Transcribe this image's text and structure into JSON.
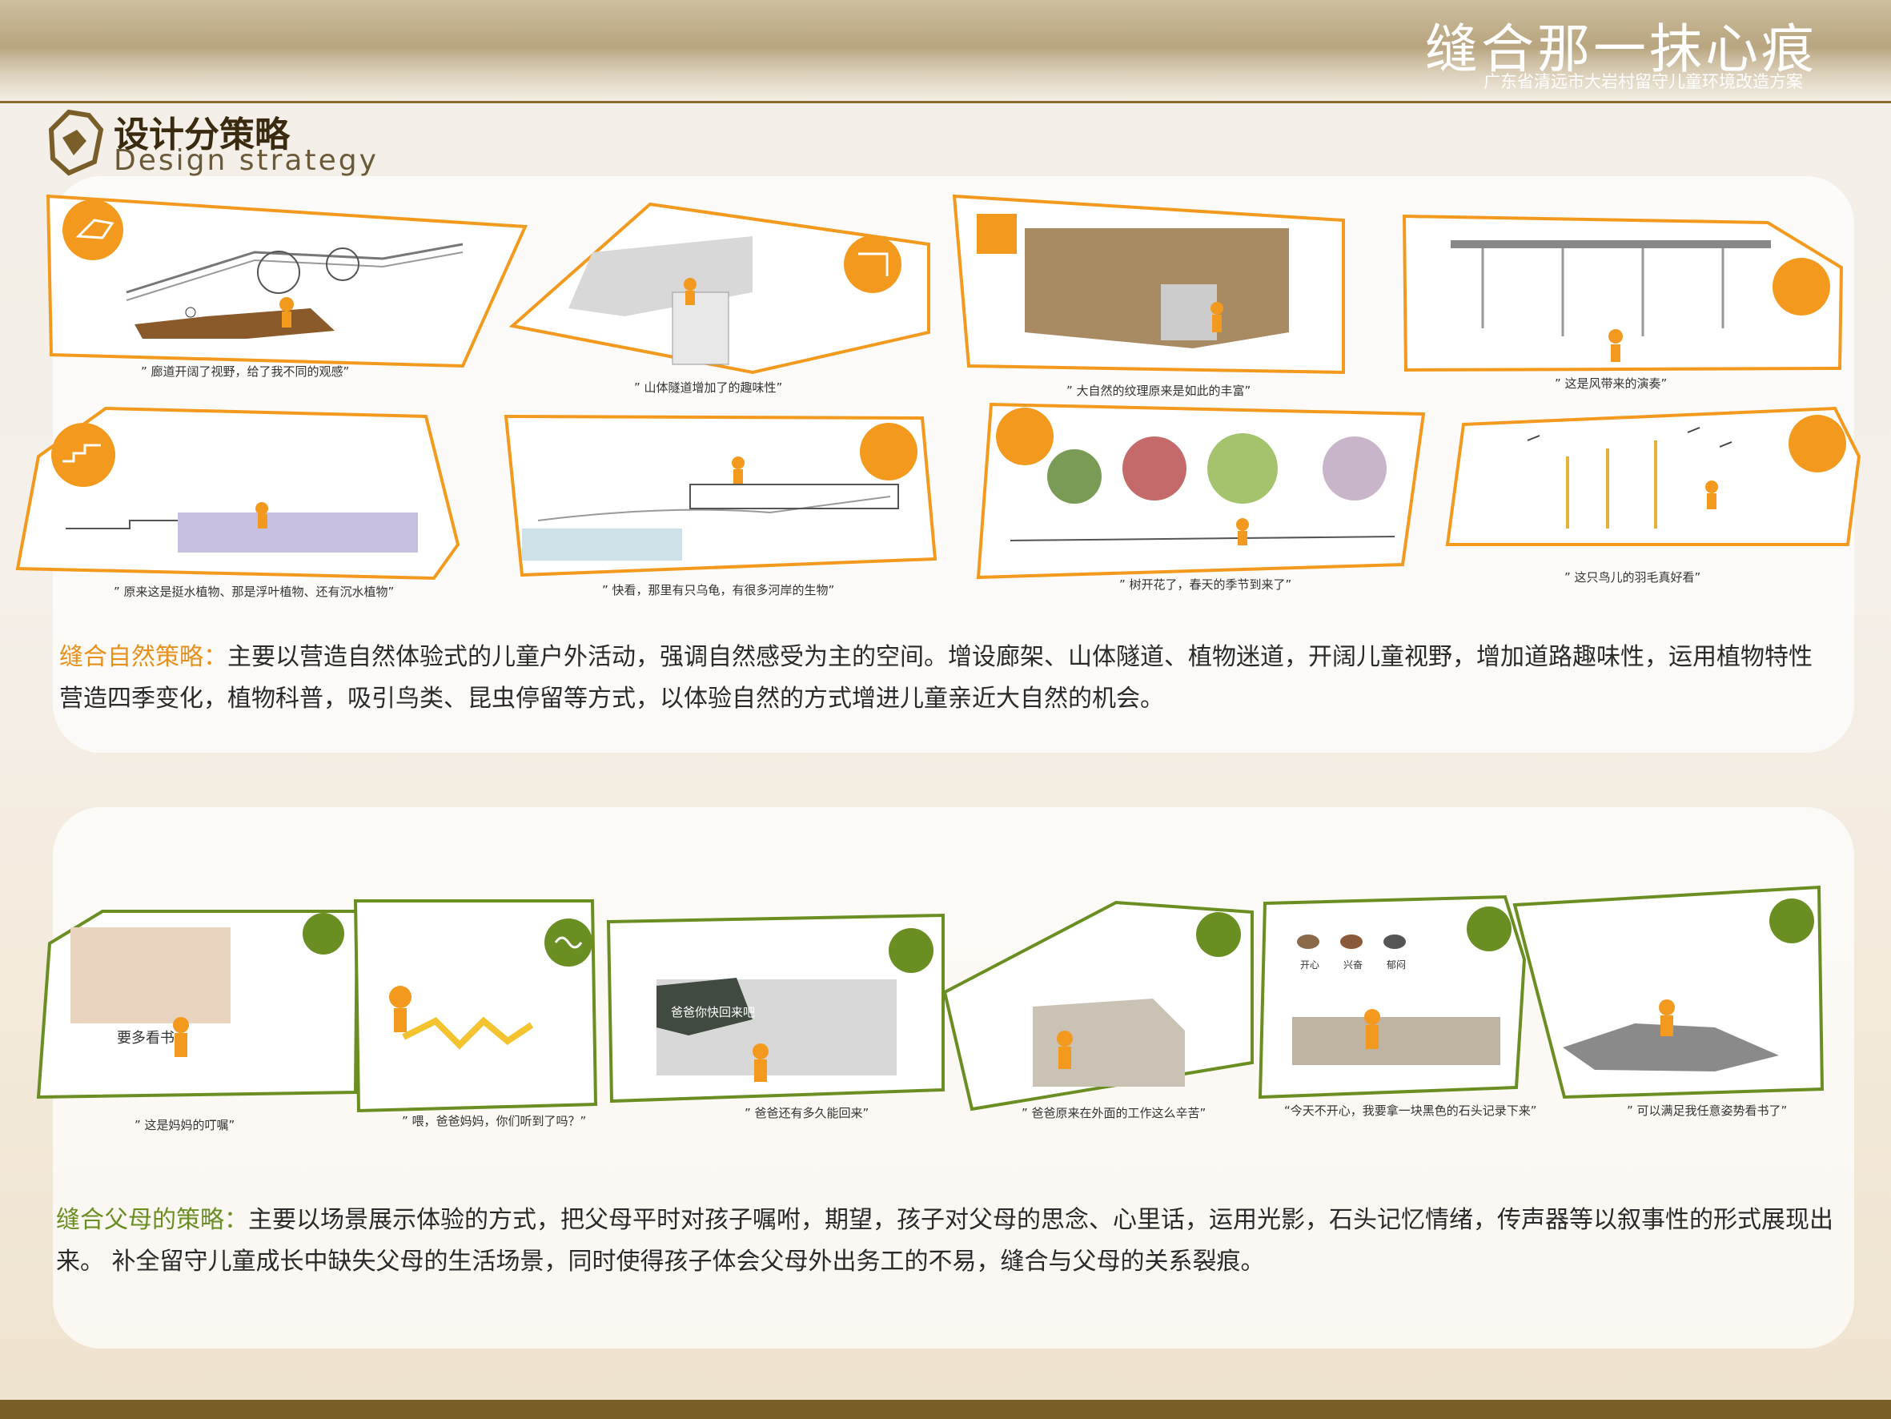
{
  "header": {
    "title": "缝合那一抹心痕",
    "subtitle": "广东省清远市大岩村留守儿童环境改造方案"
  },
  "section": {
    "title": "设计分策略",
    "subtitle": "Design strategy"
  },
  "nature": {
    "captions": [
      "” 廊道开阔了视野，给了我不同的观感”",
      "” 山体隧道增加了的趣味性”",
      "” 大自然的纹理原来是如此的丰富”",
      "” 这是风带来的演奏”",
      "” 原来这是挺水植物、那是浮叶植物、还有沉水植物”",
      "” 快看，那里有只乌龟，有很多河岸的生物”",
      "” 树开花了，春天的季节到来了”",
      "” 这只鸟儿的羽毛真好看”"
    ],
    "lead": "缝合自然策略：",
    "body": "主要以营造自然体验式的儿童户外活动，强调自然感受为主的空间。增设廊架、山体隧道、植物迷道，开阔儿童视野，增加道路趣味性，运用植物特性营造四季变化，植物科普，吸引鸟类、昆虫停留等方式，以体验自然的方式增进儿童亲近大自然的机会。"
  },
  "parents": {
    "captions": [
      "” 这是妈妈的叮嘱”",
      "” 喂，爸爸妈妈，你们听到了吗？”",
      "” 爸爸还有多久能回来”",
      "” 爸爸原来在外面的工作这么辛苦”",
      "“今天不开心，我要拿一块黑色的石头记录下来”",
      "” 可以满足我任意姿势看书了”"
    ],
    "scene_texts": {
      "reading": "要多看书",
      "chalkboard": "爸爸你快回来吧",
      "stone_happy": "开心",
      "stone_excited": "兴奋",
      "stone_gloomy": "郁闷"
    },
    "lead": "缝合父母的策略：",
    "body": "主要以场景展示体验的方式，把父母平时对孩子嘱咐，期望，孩子对父母的思念、心里话，运用光影，石头记忆情绪，传声器等以叙事性的形式展现出来。 补全留守儿童成长中缺失父母的生活场景，同时使得孩子体会父母外出务工的不易，缝合与父母的关系裂痕。"
  },
  "colors": {
    "orange": "#f39a1e",
    "green": "#6b8e23",
    "brown": "#7a5e2a"
  }
}
